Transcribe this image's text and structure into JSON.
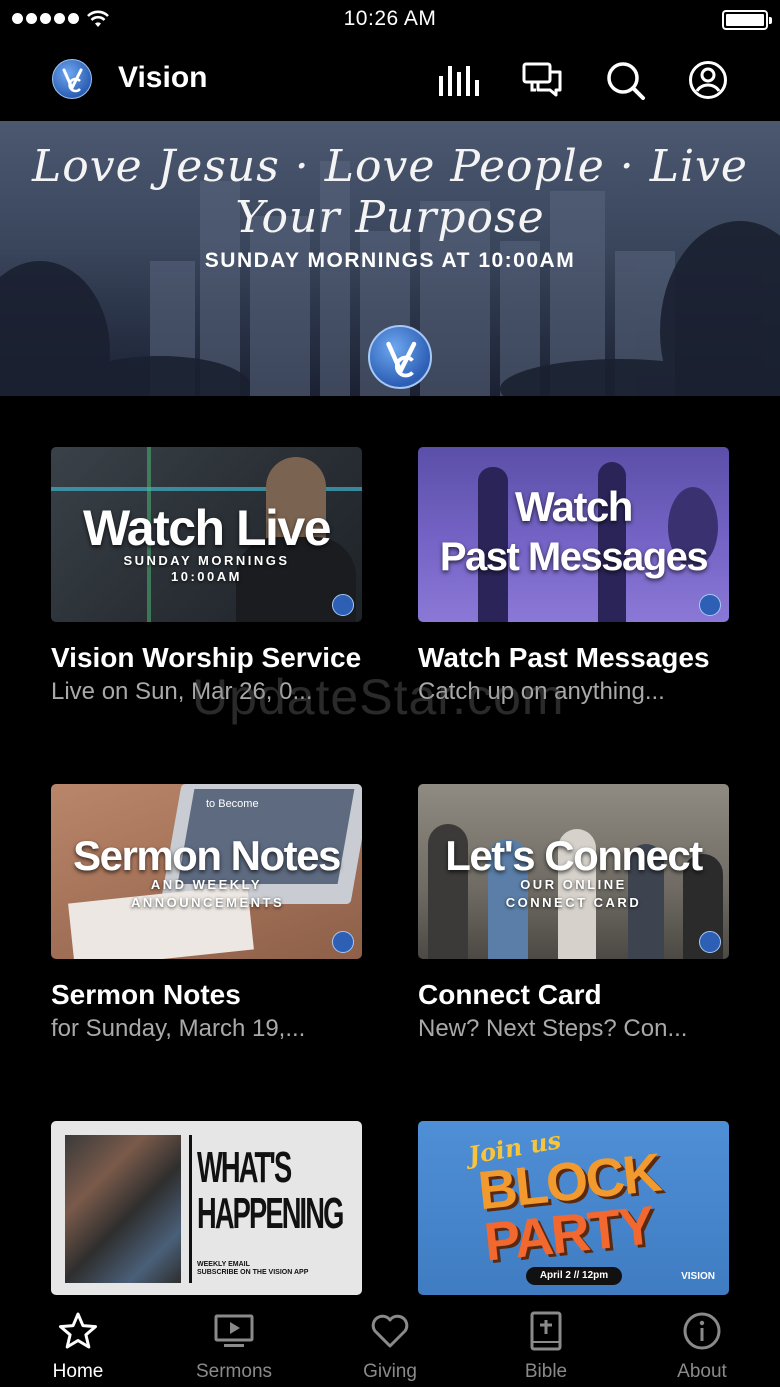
{
  "status_bar": {
    "time": "10:26 AM"
  },
  "header": {
    "app_title": "Vision"
  },
  "banner": {
    "script_text": "Love Jesus · Love People · Live Your Purpose",
    "subtitle": "SUNDAY MORNINGS AT 10:00AM"
  },
  "cards": [
    {
      "thumb_title": "Watch Live",
      "thumb_sub": "SUNDAY MORNINGS 10:00AM",
      "title": "Vision Worship Service",
      "subtitle": "Live on Sun, Mar 26, 0..."
    },
    {
      "thumb_title_1": "Watch",
      "thumb_title_2": "Past Messages",
      "title": "Watch Past Messages",
      "subtitle": "Catch up on anything..."
    },
    {
      "thumb_title": "Sermon Notes",
      "thumb_sub": "AND WEEKLY ANNOUNCEMENTS",
      "thumb_paper": "to Become",
      "title": "Sermon Notes",
      "subtitle": "for Sunday, March 19,..."
    },
    {
      "thumb_title": "Let's Connect",
      "thumb_sub": "OUR ONLINE CONNECT CARD",
      "title": "Connect Card",
      "subtitle": "New? Next Steps? Con..."
    },
    {
      "thumb_title_1": "WHAT'S",
      "thumb_title_2": "HAPPENING",
      "thumb_sub_1": "WEEKLY EMAIL",
      "thumb_sub_2": "SUBSCRIBE ON THE VISION APP"
    },
    {
      "thumb_script": "Join us",
      "thumb_title_1": "BLOCK",
      "thumb_title_2": "PARTY",
      "thumb_date": "April 2 // 12pm",
      "thumb_brand": "VISION"
    }
  ],
  "watermark": "UpdateStar.com",
  "tabs": [
    {
      "label": "Home",
      "icon": "star-icon",
      "active": true
    },
    {
      "label": "Sermons",
      "icon": "tv-play-icon",
      "active": false
    },
    {
      "label": "Giving",
      "icon": "heart-icon",
      "active": false
    },
    {
      "label": "Bible",
      "icon": "bible-icon",
      "active": false
    },
    {
      "label": "About",
      "icon": "info-icon",
      "active": false
    }
  ],
  "colors": {
    "background": "#000000",
    "brand_blue": "#2d5fb5",
    "muted_text": "#a9a9a9",
    "inactive_tab": "#8a8a8a"
  }
}
